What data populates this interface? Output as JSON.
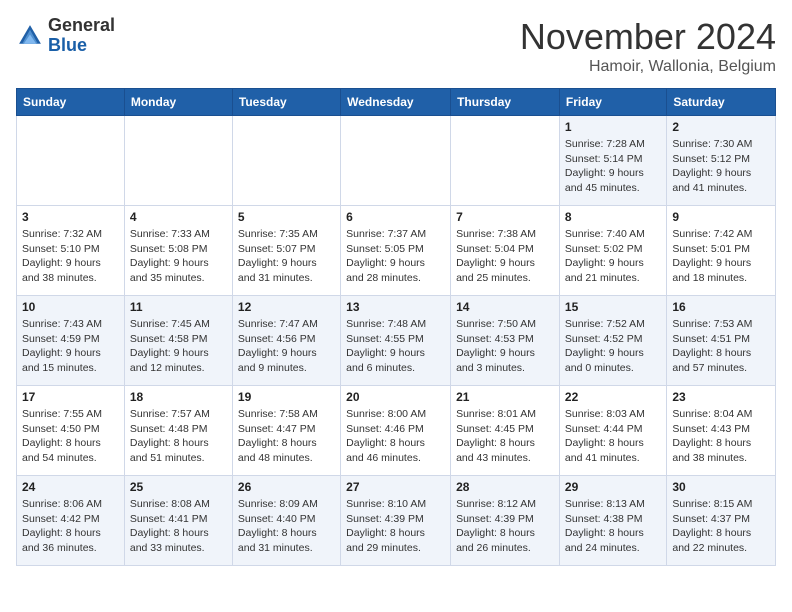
{
  "logo": {
    "general": "General",
    "blue": "Blue"
  },
  "header": {
    "month": "November 2024",
    "location": "Hamoir, Wallonia, Belgium"
  },
  "weekdays": [
    "Sunday",
    "Monday",
    "Tuesday",
    "Wednesday",
    "Thursday",
    "Friday",
    "Saturday"
  ],
  "weeks": [
    [
      {
        "day": "",
        "sunrise": "",
        "sunset": "",
        "daylight": ""
      },
      {
        "day": "",
        "sunrise": "",
        "sunset": "",
        "daylight": ""
      },
      {
        "day": "",
        "sunrise": "",
        "sunset": "",
        "daylight": ""
      },
      {
        "day": "",
        "sunrise": "",
        "sunset": "",
        "daylight": ""
      },
      {
        "day": "",
        "sunrise": "",
        "sunset": "",
        "daylight": ""
      },
      {
        "day": "1",
        "sunrise": "Sunrise: 7:28 AM",
        "sunset": "Sunset: 5:14 PM",
        "daylight": "Daylight: 9 hours and 45 minutes."
      },
      {
        "day": "2",
        "sunrise": "Sunrise: 7:30 AM",
        "sunset": "Sunset: 5:12 PM",
        "daylight": "Daylight: 9 hours and 41 minutes."
      }
    ],
    [
      {
        "day": "3",
        "sunrise": "Sunrise: 7:32 AM",
        "sunset": "Sunset: 5:10 PM",
        "daylight": "Daylight: 9 hours and 38 minutes."
      },
      {
        "day": "4",
        "sunrise": "Sunrise: 7:33 AM",
        "sunset": "Sunset: 5:08 PM",
        "daylight": "Daylight: 9 hours and 35 minutes."
      },
      {
        "day": "5",
        "sunrise": "Sunrise: 7:35 AM",
        "sunset": "Sunset: 5:07 PM",
        "daylight": "Daylight: 9 hours and 31 minutes."
      },
      {
        "day": "6",
        "sunrise": "Sunrise: 7:37 AM",
        "sunset": "Sunset: 5:05 PM",
        "daylight": "Daylight: 9 hours and 28 minutes."
      },
      {
        "day": "7",
        "sunrise": "Sunrise: 7:38 AM",
        "sunset": "Sunset: 5:04 PM",
        "daylight": "Daylight: 9 hours and 25 minutes."
      },
      {
        "day": "8",
        "sunrise": "Sunrise: 7:40 AM",
        "sunset": "Sunset: 5:02 PM",
        "daylight": "Daylight: 9 hours and 21 minutes."
      },
      {
        "day": "9",
        "sunrise": "Sunrise: 7:42 AM",
        "sunset": "Sunset: 5:01 PM",
        "daylight": "Daylight: 9 hours and 18 minutes."
      }
    ],
    [
      {
        "day": "10",
        "sunrise": "Sunrise: 7:43 AM",
        "sunset": "Sunset: 4:59 PM",
        "daylight": "Daylight: 9 hours and 15 minutes."
      },
      {
        "day": "11",
        "sunrise": "Sunrise: 7:45 AM",
        "sunset": "Sunset: 4:58 PM",
        "daylight": "Daylight: 9 hours and 12 minutes."
      },
      {
        "day": "12",
        "sunrise": "Sunrise: 7:47 AM",
        "sunset": "Sunset: 4:56 PM",
        "daylight": "Daylight: 9 hours and 9 minutes."
      },
      {
        "day": "13",
        "sunrise": "Sunrise: 7:48 AM",
        "sunset": "Sunset: 4:55 PM",
        "daylight": "Daylight: 9 hours and 6 minutes."
      },
      {
        "day": "14",
        "sunrise": "Sunrise: 7:50 AM",
        "sunset": "Sunset: 4:53 PM",
        "daylight": "Daylight: 9 hours and 3 minutes."
      },
      {
        "day": "15",
        "sunrise": "Sunrise: 7:52 AM",
        "sunset": "Sunset: 4:52 PM",
        "daylight": "Daylight: 9 hours and 0 minutes."
      },
      {
        "day": "16",
        "sunrise": "Sunrise: 7:53 AM",
        "sunset": "Sunset: 4:51 PM",
        "daylight": "Daylight: 8 hours and 57 minutes."
      }
    ],
    [
      {
        "day": "17",
        "sunrise": "Sunrise: 7:55 AM",
        "sunset": "Sunset: 4:50 PM",
        "daylight": "Daylight: 8 hours and 54 minutes."
      },
      {
        "day": "18",
        "sunrise": "Sunrise: 7:57 AM",
        "sunset": "Sunset: 4:48 PM",
        "daylight": "Daylight: 8 hours and 51 minutes."
      },
      {
        "day": "19",
        "sunrise": "Sunrise: 7:58 AM",
        "sunset": "Sunset: 4:47 PM",
        "daylight": "Daylight: 8 hours and 48 minutes."
      },
      {
        "day": "20",
        "sunrise": "Sunrise: 8:00 AM",
        "sunset": "Sunset: 4:46 PM",
        "daylight": "Daylight: 8 hours and 46 minutes."
      },
      {
        "day": "21",
        "sunrise": "Sunrise: 8:01 AM",
        "sunset": "Sunset: 4:45 PM",
        "daylight": "Daylight: 8 hours and 43 minutes."
      },
      {
        "day": "22",
        "sunrise": "Sunrise: 8:03 AM",
        "sunset": "Sunset: 4:44 PM",
        "daylight": "Daylight: 8 hours and 41 minutes."
      },
      {
        "day": "23",
        "sunrise": "Sunrise: 8:04 AM",
        "sunset": "Sunset: 4:43 PM",
        "daylight": "Daylight: 8 hours and 38 minutes."
      }
    ],
    [
      {
        "day": "24",
        "sunrise": "Sunrise: 8:06 AM",
        "sunset": "Sunset: 4:42 PM",
        "daylight": "Daylight: 8 hours and 36 minutes."
      },
      {
        "day": "25",
        "sunrise": "Sunrise: 8:08 AM",
        "sunset": "Sunset: 4:41 PM",
        "daylight": "Daylight: 8 hours and 33 minutes."
      },
      {
        "day": "26",
        "sunrise": "Sunrise: 8:09 AM",
        "sunset": "Sunset: 4:40 PM",
        "daylight": "Daylight: 8 hours and 31 minutes."
      },
      {
        "day": "27",
        "sunrise": "Sunrise: 8:10 AM",
        "sunset": "Sunset: 4:39 PM",
        "daylight": "Daylight: 8 hours and 29 minutes."
      },
      {
        "day": "28",
        "sunrise": "Sunrise: 8:12 AM",
        "sunset": "Sunset: 4:39 PM",
        "daylight": "Daylight: 8 hours and 26 minutes."
      },
      {
        "day": "29",
        "sunrise": "Sunrise: 8:13 AM",
        "sunset": "Sunset: 4:38 PM",
        "daylight": "Daylight: 8 hours and 24 minutes."
      },
      {
        "day": "30",
        "sunrise": "Sunrise: 8:15 AM",
        "sunset": "Sunset: 4:37 PM",
        "daylight": "Daylight: 8 hours and 22 minutes."
      }
    ]
  ]
}
